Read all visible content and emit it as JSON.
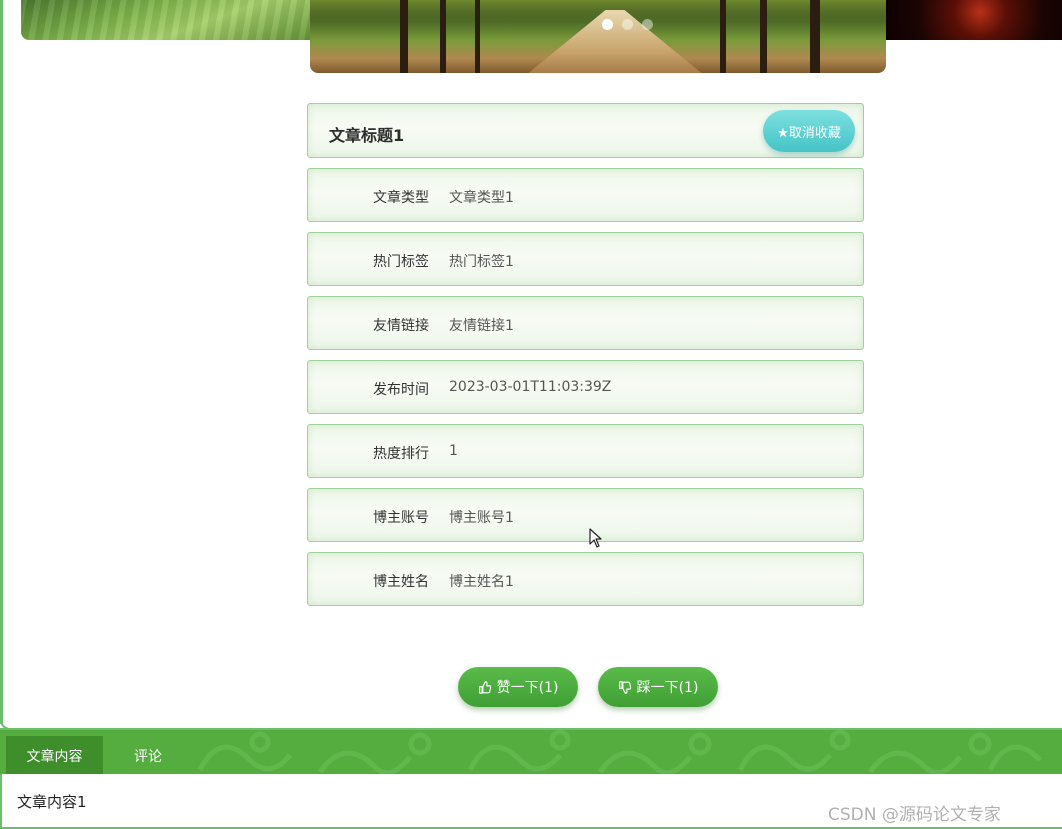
{
  "article": {
    "title": "文章标题1",
    "favorite_button": "★取消收藏",
    "fields": [
      {
        "label": "文章类型",
        "value": "文章类型1"
      },
      {
        "label": "热门标签",
        "value": "热门标签1"
      },
      {
        "label": "友情链接",
        "value": "友情链接1"
      },
      {
        "label": "发布时间",
        "value": "2023-03-01T11:03:39Z"
      },
      {
        "label": "热度排行",
        "value": "1"
      },
      {
        "label": "博主账号",
        "value": "博主账号1"
      },
      {
        "label": "博主姓名",
        "value": "博主姓名1"
      }
    ]
  },
  "actions": {
    "like_label": "赞一下(1)",
    "dislike_label": "踩一下(1)"
  },
  "carousel": {
    "slide_count": 3,
    "active_index": 0
  },
  "tabs": [
    {
      "label": "文章内容",
      "active": true
    },
    {
      "label": "评论",
      "active": false
    }
  ],
  "content": {
    "text": "文章内容1"
  },
  "watermark": "CSDN @源码论文专家",
  "colors": {
    "accent_green": "#55ad3f",
    "border_green": "#9fd19a",
    "favorite_teal": "#45c3c6"
  }
}
